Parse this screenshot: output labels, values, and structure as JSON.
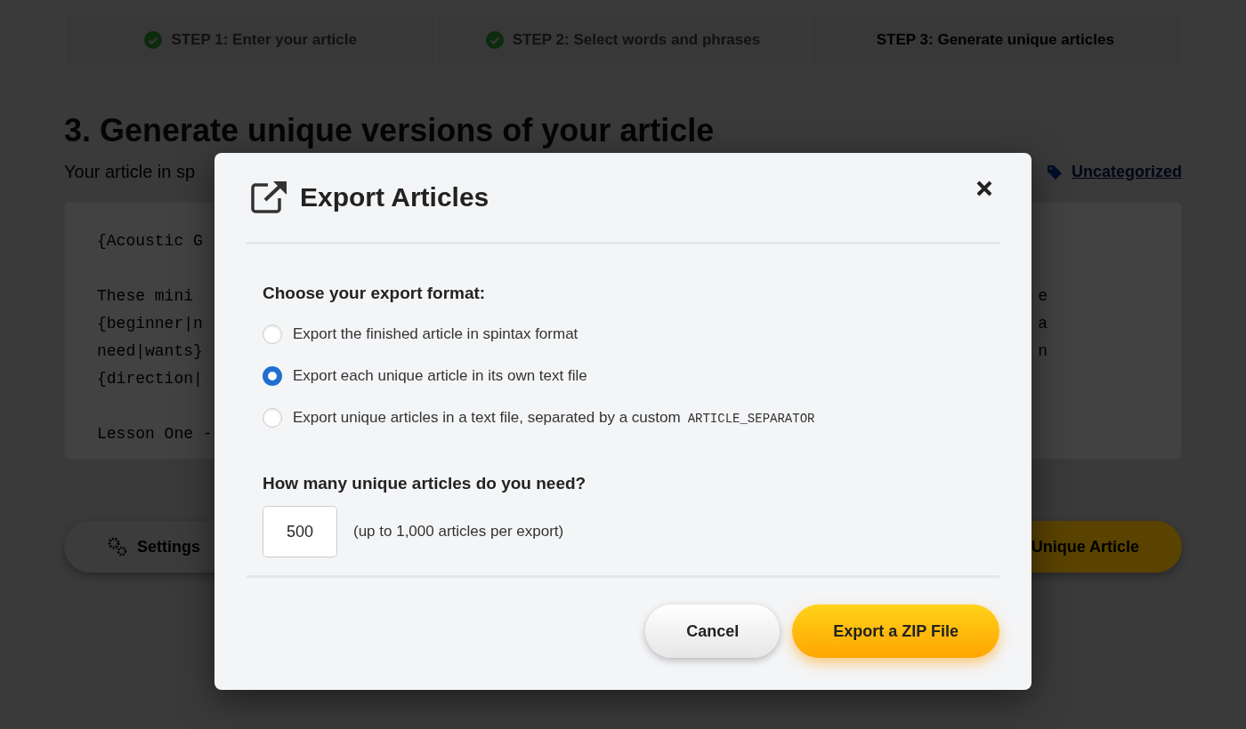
{
  "steps": [
    {
      "label": "STEP 1: Enter your article",
      "done": true,
      "selected": false
    },
    {
      "label": "STEP 2: Select words and phrases",
      "done": true,
      "selected": false
    },
    {
      "label": "STEP 3: Generate unique articles",
      "done": false,
      "selected": true
    }
  ],
  "page": {
    "heading": "3. Generate unique versions of your article",
    "subtitle": "Your article in sp",
    "category": "Uncategorized",
    "article_paragraphs": [
      [
        {
          "left": "{Acoustic G"
        }
      ],
      [
        {
          "left": "These mini",
          "right": "e"
        },
        {
          "left": "{beginner|n",
          "right": "a"
        },
        {
          "left": "need|wants}",
          "right": "n"
        },
        {
          "left": "{direction|"
        }
      ],
      [
        {
          "left": "Lesson One -"
        }
      ]
    ],
    "settings_button": "Settings",
    "generate_button": "Unique Article"
  },
  "dialog": {
    "title": "Export Articles",
    "format_label": "Choose your export format:",
    "formats": [
      {
        "label": "Export the finished article in spintax format",
        "selected": false
      },
      {
        "label": "Export each unique article in its own text file",
        "selected": true
      },
      {
        "label": "Export unique articles in a text file, separated by a custom",
        "code": "ARTICLE_SEPARATOR",
        "selected": false
      }
    ],
    "count_label": "How many unique articles do you need?",
    "count_value": "500",
    "count_hint": "(up to 1,000 articles per export)",
    "cancel_button": "Cancel",
    "export_button": "Export a ZIP File"
  }
}
